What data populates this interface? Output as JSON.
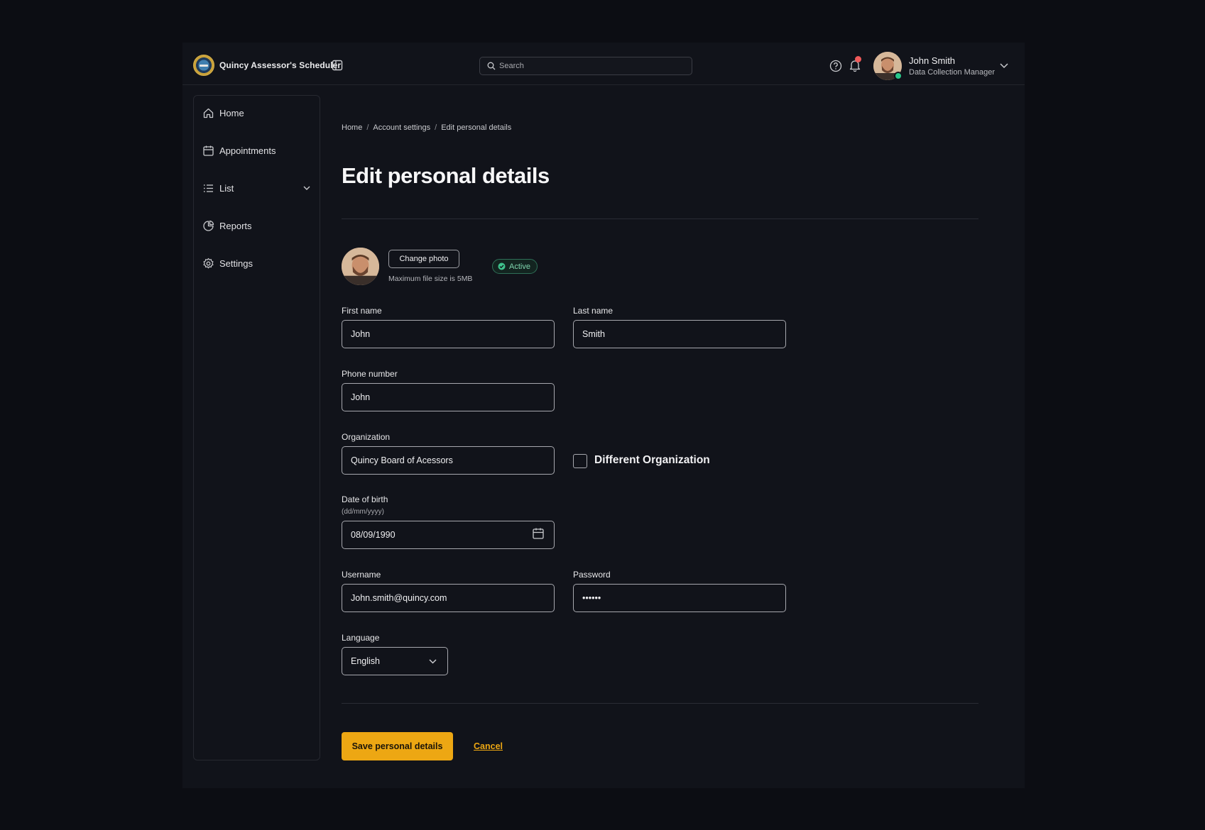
{
  "header": {
    "app_title": "Quincy Assessor's Scheduler",
    "search_placeholder": "Search",
    "user_name": "John Smith",
    "user_role": "Data Collection Manager",
    "notification_dot_color": "#f05a5a"
  },
  "sidebar": {
    "items": [
      {
        "label": "Home",
        "icon": "home-icon"
      },
      {
        "label": "Appointments",
        "icon": "calendar-icon"
      },
      {
        "label": "List",
        "icon": "list-icon",
        "expandable": true
      },
      {
        "label": "Reports",
        "icon": "pie-chart-icon"
      },
      {
        "label": "Settings",
        "icon": "gear-icon"
      }
    ]
  },
  "breadcrumb": [
    "Home",
    "Account settings",
    "Edit personal details"
  ],
  "page_title": "Edit personal details",
  "photo": {
    "change_label": "Change photo",
    "hint": "Maximum file size is 5MB",
    "status": "Active",
    "status_color": "#7fd4ad"
  },
  "form": {
    "first_name": {
      "label": "First name",
      "value": "John"
    },
    "last_name": {
      "label": "Last name",
      "value": "Smith"
    },
    "phone": {
      "label": "Phone number",
      "value": "John"
    },
    "organization": {
      "label": "Organization",
      "value": "Quincy Board of Acessors"
    },
    "different_org": {
      "label": "Different Organization",
      "checked": false
    },
    "dob": {
      "label": "Date of birth",
      "sublabel": "(dd/mm/yyyy)",
      "value": "08/09/1990"
    },
    "username": {
      "label": "Username",
      "value": "John.smith@quincy.com"
    },
    "password": {
      "label": "Password",
      "value": "••••••"
    },
    "language": {
      "label": "Language",
      "value": "English"
    }
  },
  "actions": {
    "save_label": "Save personal details",
    "cancel_label": "Cancel",
    "accent_color": "#eda713"
  }
}
